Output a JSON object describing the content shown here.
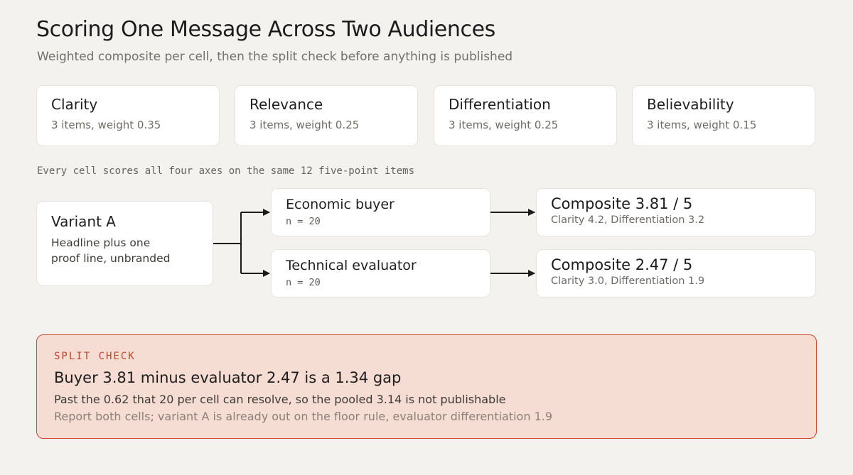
{
  "header": {
    "title": "Scoring One Message Across Two Audiences",
    "subtitle": "Weighted composite per cell, then the split check before anything is published"
  },
  "axes": [
    {
      "name": "Clarity",
      "meta": "3 items, weight 0.35"
    },
    {
      "name": "Relevance",
      "meta": "3 items, weight 0.25"
    },
    {
      "name": "Differentiation",
      "meta": "3 items, weight 0.25"
    },
    {
      "name": "Believability",
      "meta": "3 items, weight 0.15"
    }
  ],
  "note": "Every cell scores all four axes on the same 12 five-point items",
  "variant": {
    "title": "Variant A",
    "description": "Headline plus one proof line, unbranded"
  },
  "audiences": [
    {
      "name": "Economic buyer",
      "n": "n = 20"
    },
    {
      "name": "Technical evaluator",
      "n": "n = 20"
    }
  ],
  "composites": [
    {
      "score": "Composite 3.81 / 5",
      "detail": "Clarity 4.2, Differentiation 3.2"
    },
    {
      "score": "Composite 2.47 / 5",
      "detail": "Clarity 3.0, Differentiation 1.9"
    }
  ],
  "split_check": {
    "label": "SPLIT CHECK",
    "headline": "Buyer 3.81 minus evaluator 2.47 is a 1.34 gap",
    "line1": "Past the 0.62 that 20 per cell can resolve, so the pooled 3.14 is not publishable",
    "line2": "Report both cells; variant A is already out on the floor rule, evaluator differentiation 1.9"
  },
  "colors": {
    "background": "#f4f2ee",
    "card": "#ffffff",
    "alert_fill": "#f6ddd4",
    "alert_border": "#c9472f",
    "alert_label": "#c2452e",
    "connector": "#1a1a1a"
  }
}
